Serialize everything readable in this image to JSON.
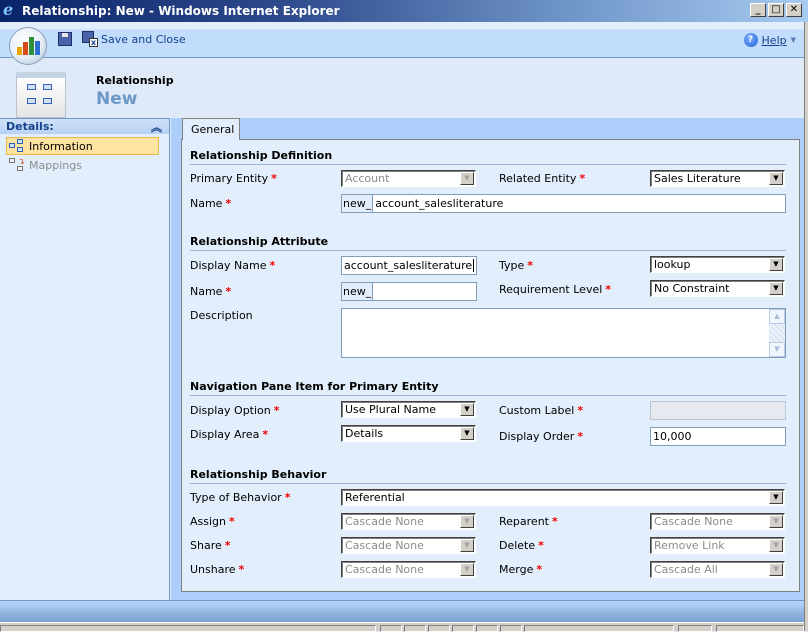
{
  "window": {
    "title": "Relationship: New - Windows Internet Explorer",
    "controls": [
      "minimize",
      "maximize",
      "close"
    ]
  },
  "toolbar": {
    "save_label": "",
    "save_close_label": "Save and Close",
    "help_label": "Help"
  },
  "header": {
    "entity_kind": "Relationship",
    "record_title": "New"
  },
  "nav": {
    "section_label": "Details:",
    "items": [
      {
        "label": "Information",
        "selected": true,
        "enabled": true
      },
      {
        "label": "Mappings",
        "selected": false,
        "enabled": false
      }
    ]
  },
  "tabs": [
    {
      "label": "General",
      "selected": true
    }
  ],
  "form": {
    "definition": {
      "heading": "Relationship Definition",
      "primary_entity": {
        "label": "Primary Entity",
        "value": "Account",
        "disabled": true
      },
      "related_entity": {
        "label": "Related Entity",
        "value": "Sales Literature"
      },
      "name": {
        "label": "Name",
        "prefix": "new_",
        "value": "account_salesliterature"
      }
    },
    "attribute": {
      "heading": "Relationship Attribute",
      "display_name": {
        "label": "Display Name",
        "value": "account_salesliterature"
      },
      "type": {
        "label": "Type",
        "value": "lookup"
      },
      "name": {
        "label": "Name",
        "prefix": "new_",
        "value": ""
      },
      "requirement_level": {
        "label": "Requirement Level",
        "value": "No Constraint"
      },
      "description": {
        "label": "Description",
        "value": ""
      }
    },
    "navigation": {
      "heading": "Navigation Pane Item for Primary Entity",
      "display_option": {
        "label": "Display Option",
        "value": "Use Plural Name"
      },
      "custom_label": {
        "label": "Custom Label",
        "value": "",
        "disabled": true
      },
      "display_area": {
        "label": "Display Area",
        "value": "Details"
      },
      "display_order": {
        "label": "Display Order",
        "value": "10,000"
      }
    },
    "behavior": {
      "heading": "Relationship Behavior",
      "type_of_behavior": {
        "label": "Type of Behavior",
        "value": "Referential"
      },
      "assign": {
        "label": "Assign",
        "value": "Cascade None",
        "disabled": true
      },
      "reparent": {
        "label": "Reparent",
        "value": "Cascade None",
        "disabled": true
      },
      "share": {
        "label": "Share",
        "value": "Cascade None",
        "disabled": true
      },
      "delete": {
        "label": "Delete",
        "value": "Remove Link",
        "disabled": true
      },
      "unshare": {
        "label": "Unshare",
        "value": "Cascade None",
        "disabled": true
      },
      "merge": {
        "label": "Merge",
        "value": "Cascade All",
        "disabled": true
      }
    }
  },
  "required_marker": "*",
  "colors": {
    "title_accent": "#6d99c9",
    "required": "#e00000",
    "selected_nav": "#ffe3a0"
  }
}
